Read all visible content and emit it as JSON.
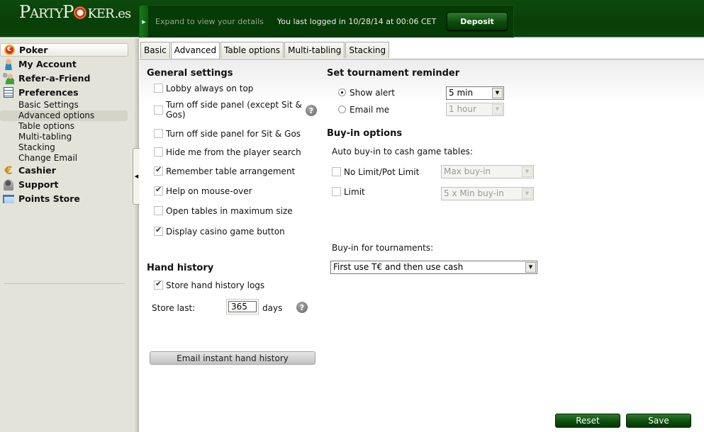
{
  "header": {
    "logo": {
      "p": "P",
      "arty": "ARTY",
      "p2": "P",
      "ker": "KER",
      "domain": ".es"
    },
    "expand_text": "Expand to view your details",
    "last_login": "You last logged in 10/28/14 at 00:06 CET",
    "deposit_label": "Deposit"
  },
  "sidebar": {
    "items": [
      {
        "label": "Poker",
        "icon": "poker-chip-icon"
      },
      {
        "label": "My Account",
        "icon": "user-icon"
      },
      {
        "label": "Refer-a-Friend",
        "icon": "refer-friend-icon"
      },
      {
        "label": "Preferences",
        "icon": "preferences-icon"
      }
    ],
    "preferences_sub": [
      "Basic Settings",
      "Advanced options",
      "Table options",
      "Multi-tabling",
      "Stacking",
      "Change Email"
    ],
    "lower_items": [
      {
        "label": "Cashier",
        "icon": "cashier-icon"
      },
      {
        "label": "Support",
        "icon": "support-icon"
      },
      {
        "label": "Points Store",
        "icon": "points-store-icon"
      }
    ]
  },
  "tabs": [
    "Basic",
    "Advanced",
    "Table options",
    "Multi-tabling",
    "Stacking"
  ],
  "active_tab": "Advanced",
  "general": {
    "title": "General settings",
    "options": [
      {
        "label": "Lobby always on top",
        "checked": false
      },
      {
        "label": "Turn off side panel (except Sit &",
        "label2": "Gos)",
        "checked": false
      },
      {
        "label": "Turn off side panel for Sit & Gos",
        "checked": false
      },
      {
        "label": "Hide me from the player search",
        "checked": false
      },
      {
        "label": "Remember table arrangement",
        "checked": true
      },
      {
        "label": "Help on mouse-over",
        "checked": true
      },
      {
        "label": "Open tables in maximum size",
        "checked": false
      },
      {
        "label": "Display casino game button",
        "checked": true
      }
    ]
  },
  "hand_history": {
    "title": "Hand history",
    "store_logs_label": "Store hand history logs",
    "store_logs_checked": true,
    "store_last_label": "Store last:",
    "store_last_value": "365",
    "days_label": "days",
    "email_button": "Email instant hand history"
  },
  "reminder": {
    "title": "Set tournament reminder",
    "show_alert_label": "Show alert",
    "show_alert_value": "5 min",
    "email_me_label": "Email me",
    "email_me_value": "1 hour",
    "selected": "Show alert"
  },
  "buyin": {
    "title": "Buy-in options",
    "auto_label": "Auto buy-in to cash game tables:",
    "nl_label": "No Limit/Pot Limit",
    "nl_checked": false,
    "nl_value": "Max buy-in",
    "limit_label": "Limit",
    "limit_checked": false,
    "limit_value": "5 x Min buy-in",
    "tournaments_label": "Buy-in for tournaments:",
    "tournaments_value": "First use T€ and then use cash"
  },
  "footer": {
    "reset_label": "Reset",
    "save_label": "Save"
  },
  "help_glyph": "?"
}
